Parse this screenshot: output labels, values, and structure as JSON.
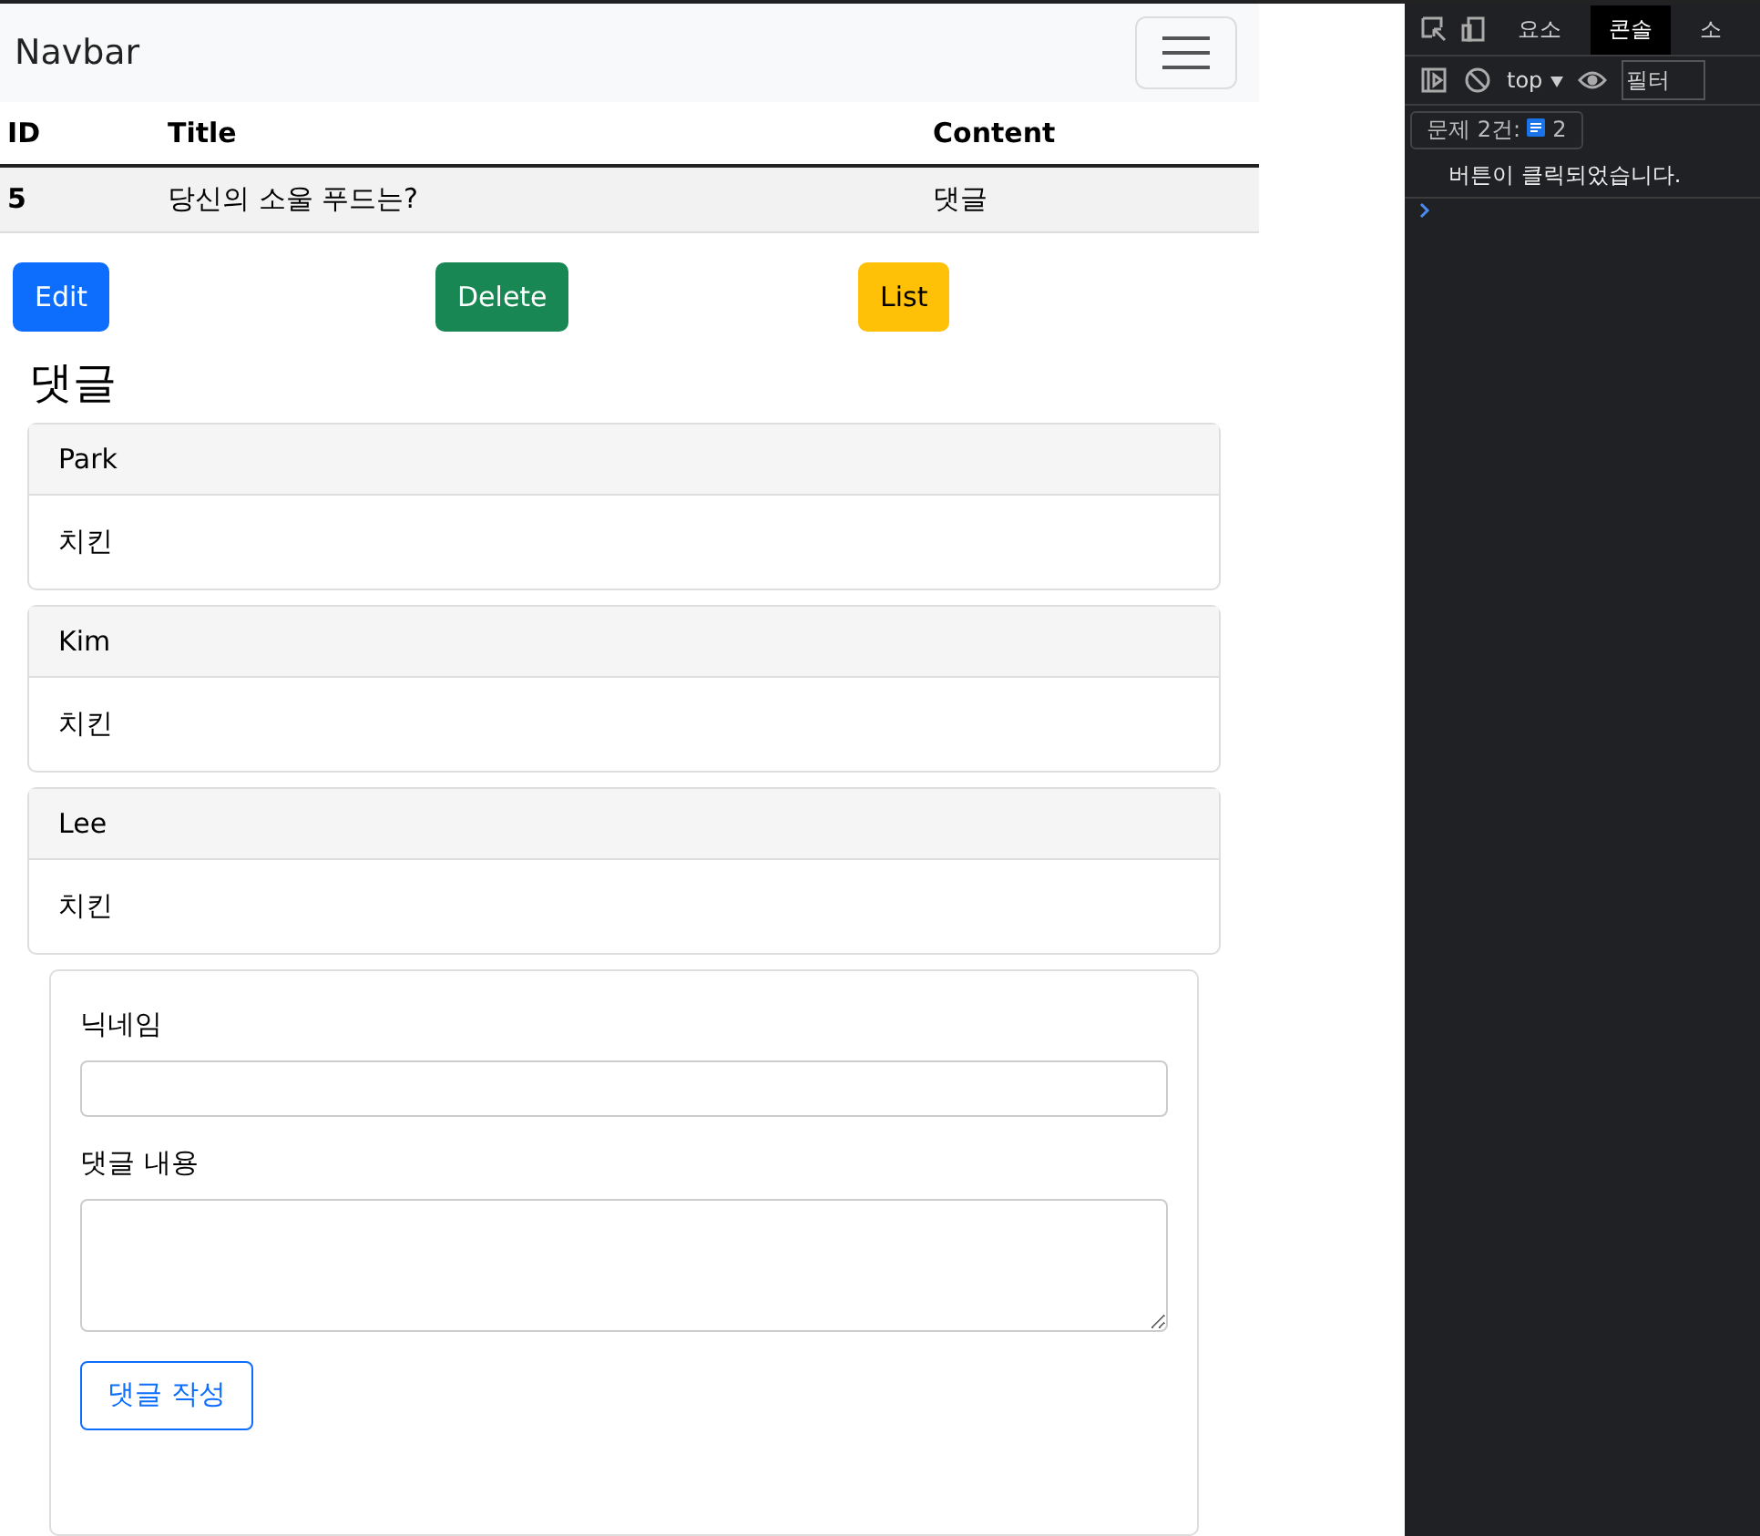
{
  "navbar": {
    "brand": "Navbar"
  },
  "table": {
    "columns": [
      "ID",
      "Title",
      "Content"
    ],
    "rows": [
      {
        "cells": [
          "5",
          "당신의 소울 푸드는?",
          "댓글"
        ]
      }
    ]
  },
  "actions": [
    {
      "label": "Edit",
      "kind": "primary"
    },
    {
      "label": "Delete",
      "kind": "success"
    },
    {
      "label": "List",
      "kind": "warning"
    }
  ],
  "comments_heading": "댓글",
  "comments": [
    {
      "author": "Park",
      "text": "치킨"
    },
    {
      "author": "Kim",
      "text": "치킨"
    },
    {
      "author": "Lee",
      "text": "치킨"
    }
  ],
  "form": {
    "nickname_label": "닉네임",
    "content_label": "댓글 내용",
    "submit": "댓글 작성"
  },
  "devtools": {
    "tabs": [
      {
        "label": "요소",
        "selected": false
      },
      {
        "label": "콘솔",
        "selected": true
      },
      {
        "label": "소",
        "selected": false
      }
    ],
    "context": "top",
    "filter_placeholder": "필터",
    "issues": {
      "label": "문제 2건:",
      "count": "2"
    },
    "messages": [
      "버튼이 클릭되었습니다."
    ]
  }
}
